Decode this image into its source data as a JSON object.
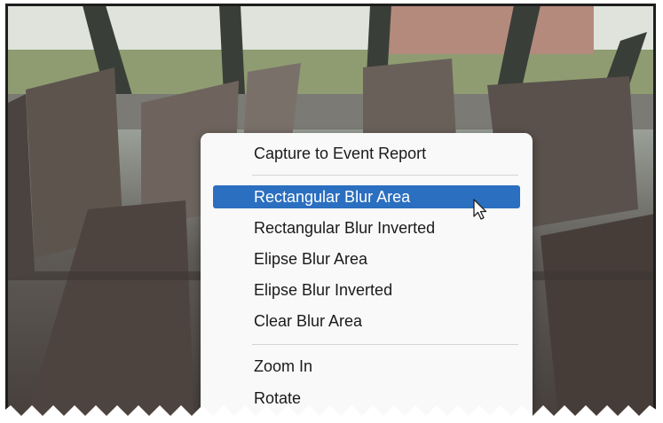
{
  "context_menu": {
    "items": [
      {
        "label": "Capture to Event Report"
      },
      {
        "label": "Rectangular Blur Area"
      },
      {
        "label": "Rectangular Blur Inverted"
      },
      {
        "label": "Elipse Blur Area"
      },
      {
        "label": "Elipse Blur Inverted"
      },
      {
        "label": "Clear Blur Area"
      },
      {
        "label": "Zoom In"
      },
      {
        "label": "Rotate"
      }
    ],
    "highlighted_item": "Rectangular Blur Area",
    "highlight_color": "#2b6fc0"
  },
  "icons": {
    "pointer": "mouse-pointer-icon"
  }
}
